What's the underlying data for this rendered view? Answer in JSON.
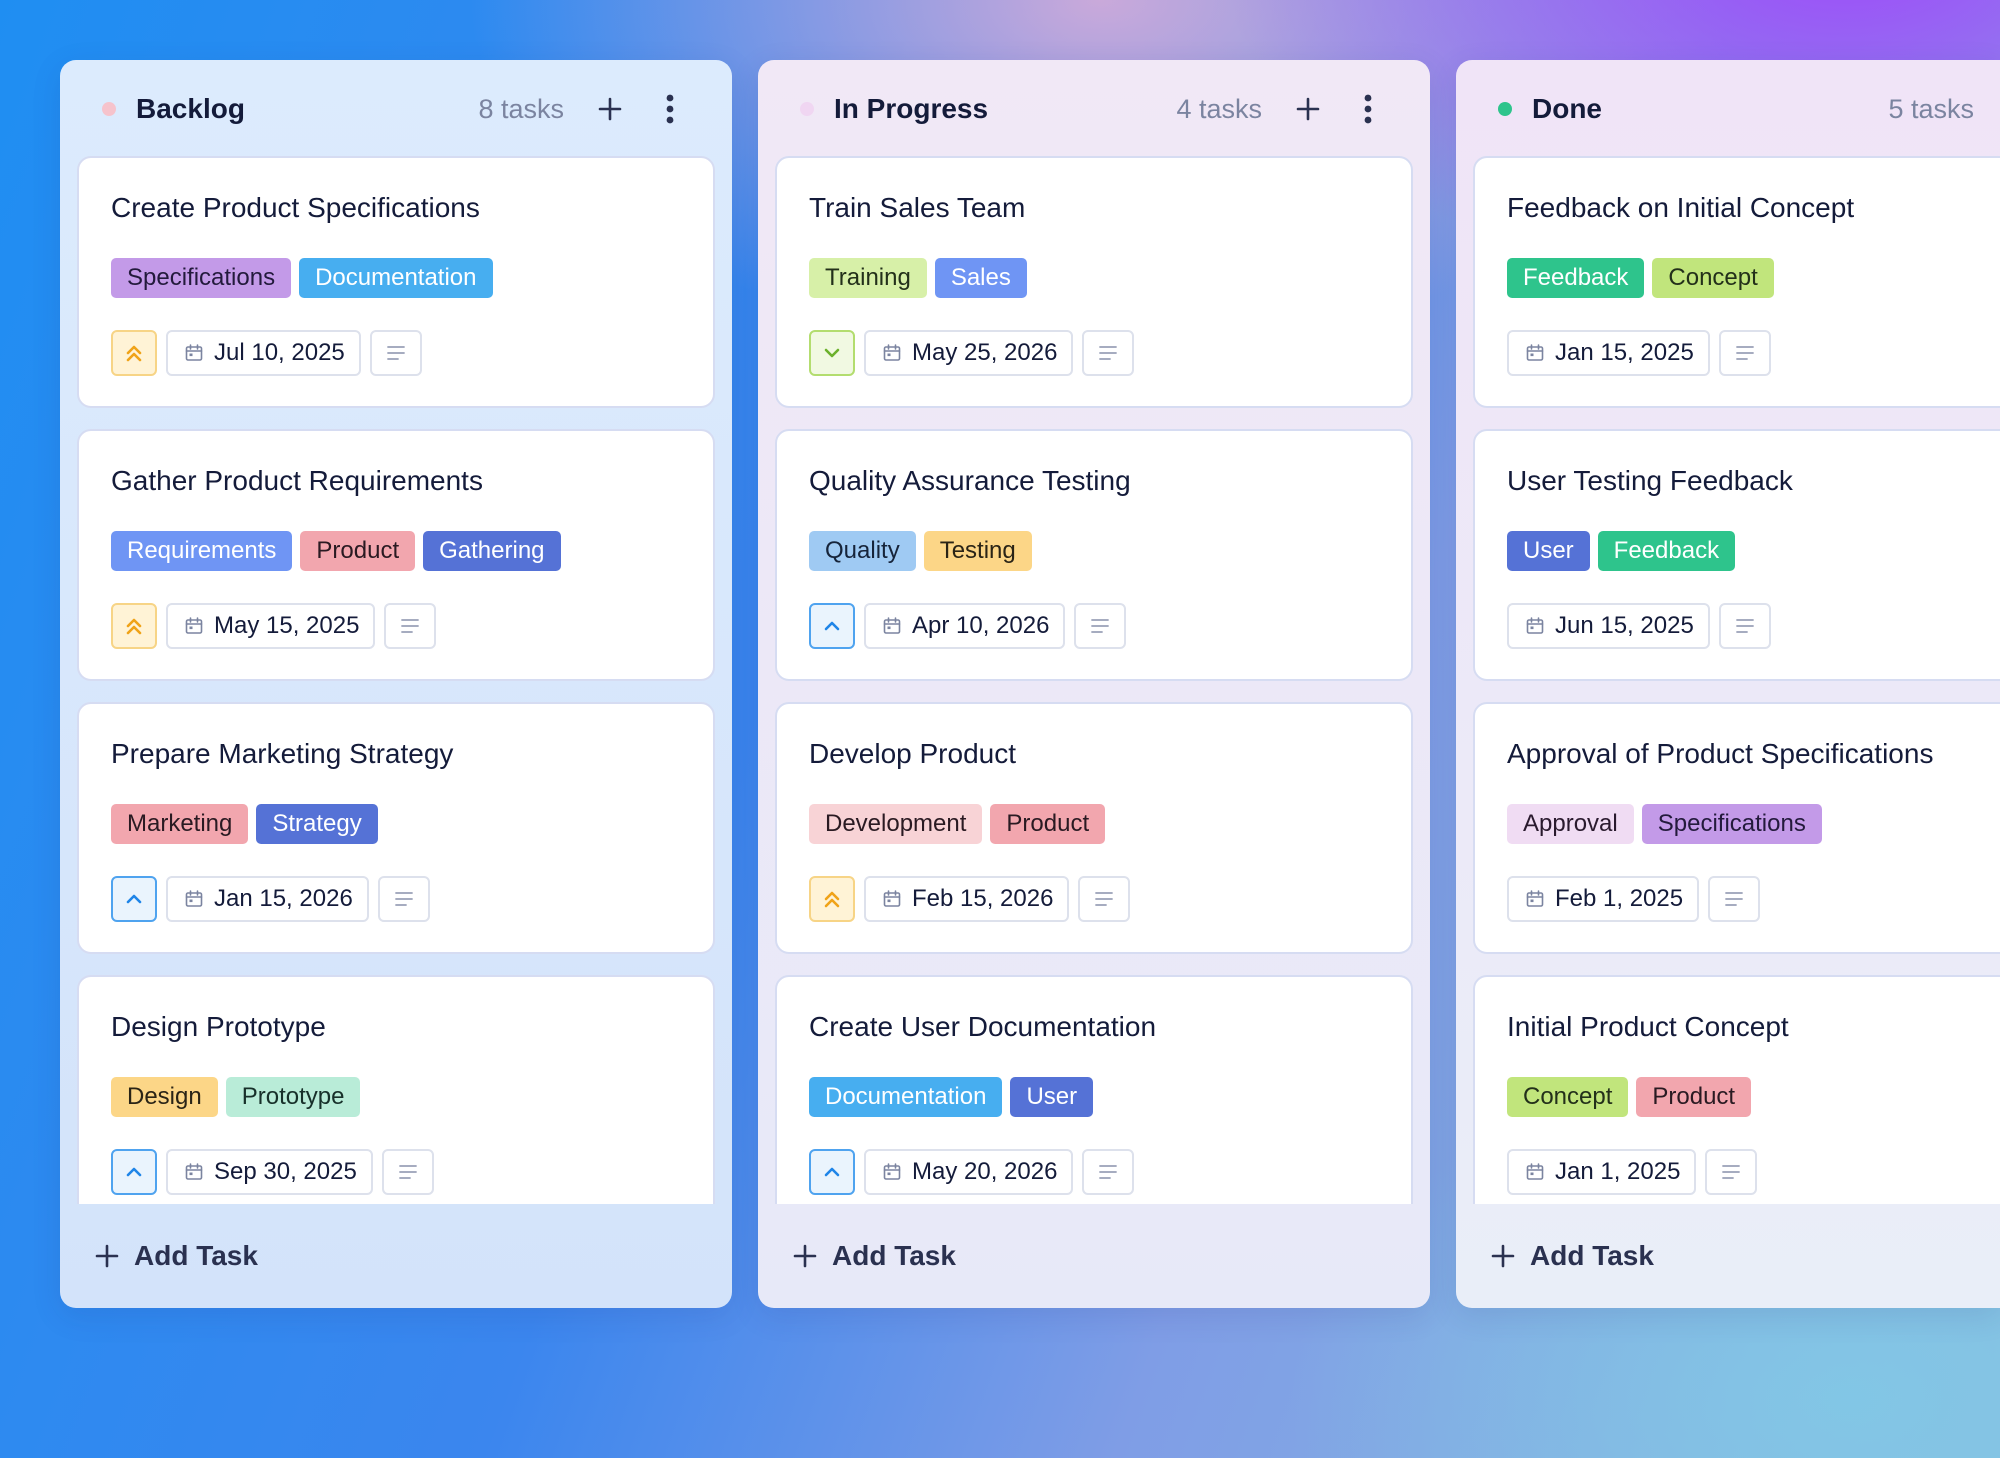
{
  "colors": {
    "tag_purple": "#c39ae8",
    "tag_sky": "#47aef0",
    "tag_blue": "#6f95f4",
    "tag_pink": "#f2a6ae",
    "tag_navy": "#5572d6",
    "tag_lightpink": "#f8d3d6",
    "tag_yellow": "#fcd687",
    "tag_mint": "#b9ecd8",
    "tag_lime": "#d7f0a8",
    "tag_lightblue": "#9fcaf3",
    "tag_green": "#2ec48c",
    "tag_chartreuse": "#c1e57c",
    "tag_lavender": "#f0dcf3"
  },
  "columns": [
    {
      "title": "Backlog",
      "count": "8 tasks",
      "dot_color": "#f6c3cc",
      "add_label": "Add Task",
      "cards": [
        {
          "title": "Create Product Specifications",
          "tags": [
            {
              "label": "Specifications",
              "bg": "#c39ae8",
              "fg": "#231a3c"
            },
            {
              "label": "Documentation",
              "bg": "#47aef0",
              "fg": "#ffffff"
            }
          ],
          "priority": "urgent",
          "date": "Jul 10, 2025"
        },
        {
          "title": "Gather Product Requirements",
          "tags": [
            {
              "label": "Requirements",
              "bg": "#6f95f4",
              "fg": "#ffffff"
            },
            {
              "label": "Product",
              "bg": "#f2a6ae",
              "fg": "#2a1a22"
            },
            {
              "label": "Gathering",
              "bg": "#5572d6",
              "fg": "#ffffff"
            }
          ],
          "priority": "urgent",
          "date": "May 15, 2025"
        },
        {
          "title": "Prepare Marketing Strategy",
          "tags": [
            {
              "label": "Marketing",
              "bg": "#f2a6ae",
              "fg": "#2a1a22"
            },
            {
              "label": "Strategy",
              "bg": "#5572d6",
              "fg": "#ffffff"
            }
          ],
          "priority": "high",
          "date": "Jan 15, 2026"
        },
        {
          "title": "Design Prototype",
          "tags": [
            {
              "label": "Design",
              "bg": "#fcd687",
              "fg": "#2a2416"
            },
            {
              "label": "Prototype",
              "bg": "#b9ecd8",
              "fg": "#17302a"
            }
          ],
          "priority": "high",
          "date": "Sep 30, 2025"
        }
      ]
    },
    {
      "title": "In Progress",
      "count": "4 tasks",
      "dot_color": "#f0d6f2",
      "add_label": "Add Task",
      "cards": [
        {
          "title": "Train Sales Team",
          "tags": [
            {
              "label": "Training",
              "bg": "#d7f0a8",
              "fg": "#23301a"
            },
            {
              "label": "Sales",
              "bg": "#6f95f4",
              "fg": "#ffffff"
            }
          ],
          "priority": "low",
          "date": "May 25, 2026"
        },
        {
          "title": "Quality Assurance Testing",
          "tags": [
            {
              "label": "Quality",
              "bg": "#9fcaf3",
              "fg": "#16243a"
            },
            {
              "label": "Testing",
              "bg": "#fcd687",
              "fg": "#2a2416"
            }
          ],
          "priority": "high",
          "date": "Apr 10, 2026"
        },
        {
          "title": "Develop Product",
          "tags": [
            {
              "label": "Development",
              "bg": "#f8d3d6",
              "fg": "#2a1a22"
            },
            {
              "label": "Product",
              "bg": "#f2a6ae",
              "fg": "#2a1a22"
            }
          ],
          "priority": "urgent",
          "date": "Feb 15, 2026"
        },
        {
          "title": "Create User Documentation",
          "tags": [
            {
              "label": "Documentation",
              "bg": "#47aef0",
              "fg": "#ffffff"
            },
            {
              "label": "User",
              "bg": "#5572d6",
              "fg": "#ffffff"
            }
          ],
          "priority": "high",
          "date": "May 20, 2026"
        }
      ]
    },
    {
      "title": "Done",
      "count": "5 tasks",
      "dot_color": "#2ec48c",
      "add_label": "Add Task",
      "cards": [
        {
          "title": "Feedback on Initial Concept",
          "tags": [
            {
              "label": "Feedback",
              "bg": "#2ec48c",
              "fg": "#ffffff"
            },
            {
              "label": "Concept",
              "bg": "#c1e57c",
              "fg": "#23301a"
            }
          ],
          "priority": "none",
          "date": "Jan 15, 2025"
        },
        {
          "title": "User Testing Feedback",
          "tags": [
            {
              "label": "User",
              "bg": "#5572d6",
              "fg": "#ffffff"
            },
            {
              "label": "Feedback",
              "bg": "#2ec48c",
              "fg": "#ffffff"
            }
          ],
          "priority": "none",
          "date": "Jun 15, 2025"
        },
        {
          "title": "Approval of Product Specifications",
          "tags": [
            {
              "label": "Approval",
              "bg": "#f0dcf3",
              "fg": "#2a1a2e"
            },
            {
              "label": "Specifications",
              "bg": "#c39ae8",
              "fg": "#231a3c"
            }
          ],
          "priority": "none",
          "date": "Feb 1, 2025"
        },
        {
          "title": "Initial Product Concept",
          "tags": [
            {
              "label": "Concept",
              "bg": "#c1e57c",
              "fg": "#23301a"
            },
            {
              "label": "Product",
              "bg": "#f2a6ae",
              "fg": "#2a1a22"
            }
          ],
          "priority": "none",
          "date": "Jan 1, 2025"
        }
      ]
    }
  ]
}
